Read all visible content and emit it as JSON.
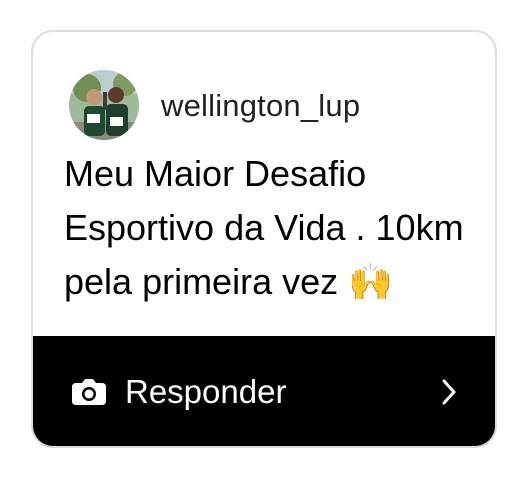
{
  "story_reply_card": {
    "username": "wellington_lup",
    "caption": "Meu Maior Desafio Esportivo da Vida . 10km pela primeira vez 🙌",
    "avatar_icon": "profile-photo-runners",
    "reply_label": "Responder",
    "reply_icon": "camera-icon",
    "action_icon": "chevron-right-icon"
  },
  "colors": {
    "footer_background": "#000000",
    "border": "#dbdbdb",
    "text": "#000000",
    "footer_text": "#ffffff"
  }
}
